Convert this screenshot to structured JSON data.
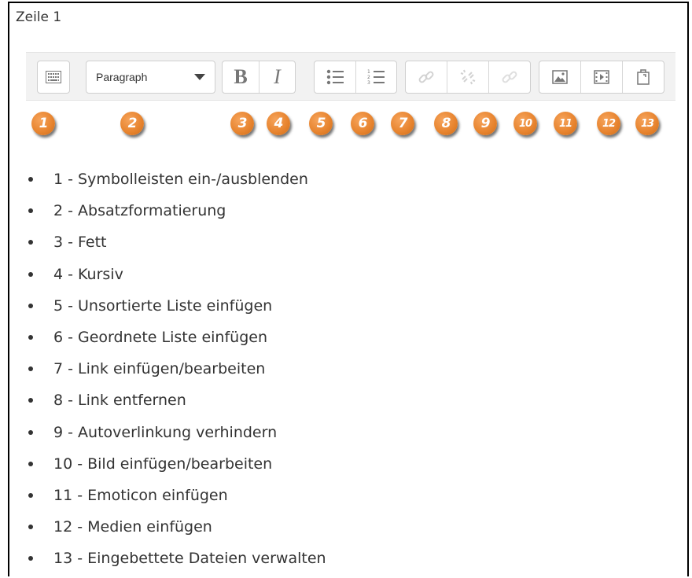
{
  "heading": "Zeile 1",
  "toolbar": {
    "format_dropdown": "Paragraph",
    "bold_label": "B",
    "italic_label": "I",
    "buttons": [
      {
        "icon": "toggle-toolbar-icon",
        "enabled": true
      },
      {
        "icon": "bold-icon",
        "enabled": true
      },
      {
        "icon": "italic-icon",
        "enabled": true
      },
      {
        "icon": "unordered-list-icon",
        "enabled": true
      },
      {
        "icon": "ordered-list-icon",
        "enabled": true
      },
      {
        "icon": "link-icon",
        "enabled": false
      },
      {
        "icon": "unlink-icon",
        "enabled": false
      },
      {
        "icon": "prevent-autolink-icon",
        "enabled": false
      },
      {
        "icon": "image-icon",
        "enabled": true
      },
      {
        "icon": "media-icon",
        "enabled": true
      },
      {
        "icon": "manage-files-icon",
        "enabled": true
      }
    ]
  },
  "badges": [
    "1",
    "2",
    "3",
    "4",
    "5",
    "6",
    "7",
    "8",
    "9",
    "10",
    "11",
    "12",
    "13"
  ],
  "badge_color": "#e88530",
  "legend": [
    "1 - Symbolleisten ein-/ausblenden",
    "2 - Absatzformatierung",
    "3 - Fett",
    "4 - Kursiv",
    "5 - Unsortierte Liste einfügen",
    "6 - Geordnete Liste einfügen",
    "7 - Link einfügen/bearbeiten",
    "8 - Link entfernen",
    "9 - Autoverlinkung verhindern",
    "10 - Bild einfügen/bearbeiten",
    "11 - Emoticon einfügen",
    "12 - Medien einfügen",
    "13 - Eingebettete Dateien verwalten"
  ]
}
